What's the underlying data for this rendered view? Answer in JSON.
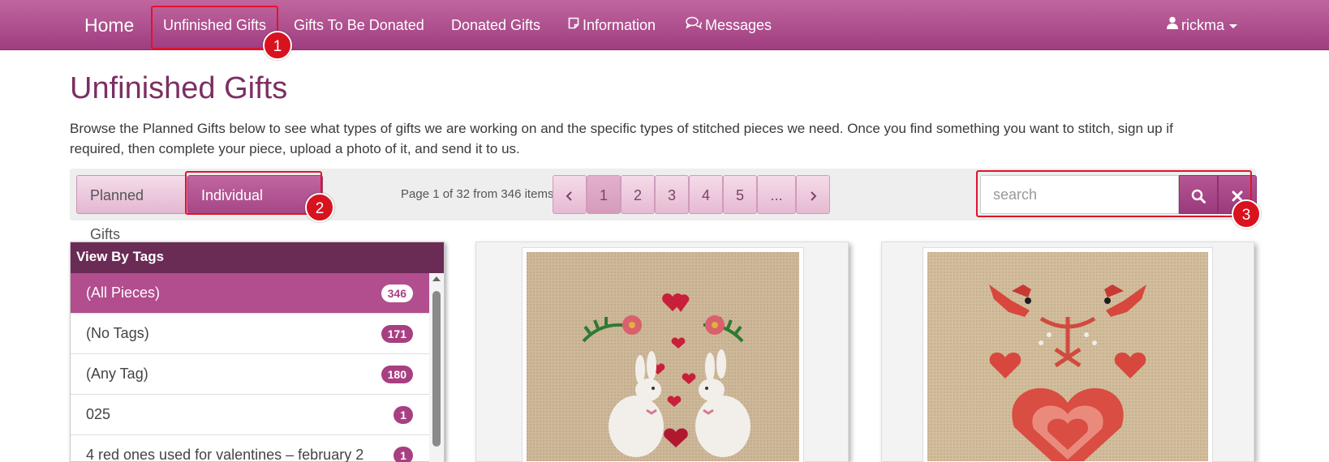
{
  "nav": {
    "home": "Home",
    "unfinished": "Unfinished Gifts",
    "to_be_donated": "Gifts To Be Donated",
    "donated": "Donated Gifts",
    "information": "Information",
    "messages": "Messages",
    "user": "rickma"
  },
  "page": {
    "title": "Unfinished Gifts",
    "intro": "Browse the Planned Gifts below to see what types of gifts we are working on and the specific types of stitched pieces we need. Once you find something you want to stitch, sign up if required, then complete your piece, upload a photo of it, and send it to us."
  },
  "toolbar": {
    "planned_label": "Planned Gifts",
    "individual_label": "Individual Pieces",
    "page_info": "Page 1 of 32 from 346 items",
    "pages": [
      "1",
      "2",
      "3",
      "4",
      "5",
      "..."
    ],
    "search_placeholder": "search"
  },
  "annotations": [
    "1",
    "2",
    "3"
  ],
  "tags": {
    "header": "View By Tags",
    "items": [
      {
        "label": "(All Pieces)",
        "count": "346"
      },
      {
        "label": "(No Tags)",
        "count": "171"
      },
      {
        "label": "(Any Tag)",
        "count": "180"
      },
      {
        "label": "025",
        "count": "1"
      },
      {
        "label": "4 red ones used for valentines – february 2",
        "count": "1"
      }
    ]
  },
  "colors": {
    "brand": "#a64788",
    "title": "#7b2f62",
    "highlight": "#e0142b"
  }
}
